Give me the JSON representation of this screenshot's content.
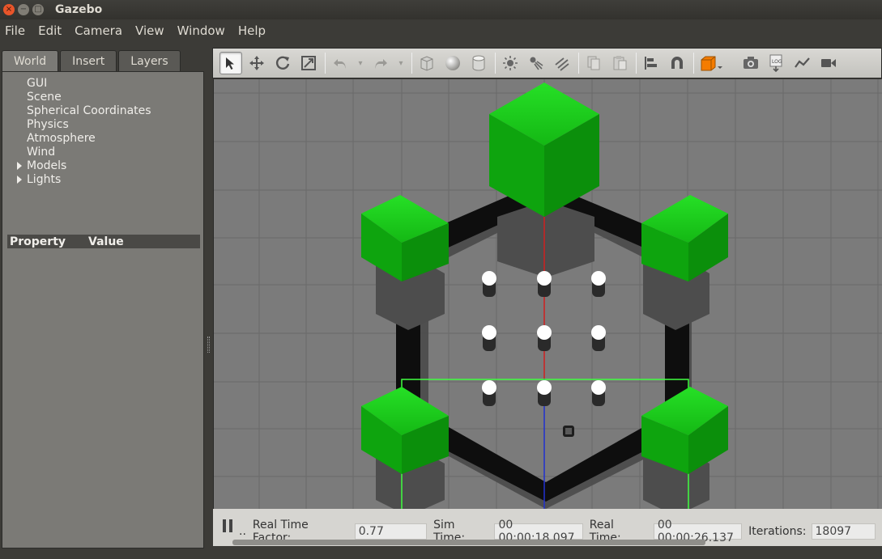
{
  "window": {
    "title": "Gazebo"
  },
  "menu": [
    "File",
    "Edit",
    "Camera",
    "View",
    "Window",
    "Help"
  ],
  "left": {
    "tabs": [
      "World",
      "Insert",
      "Layers"
    ],
    "tree": [
      "GUI",
      "Scene",
      "Spherical Coordinates",
      "Physics",
      "Atmosphere",
      "Wind",
      "Models",
      "Lights"
    ],
    "property_header": {
      "property": "Property",
      "value": "Value"
    }
  },
  "toolbar": {
    "icons": [
      "select-arrow-icon",
      "translate-icon",
      "rotate-icon",
      "scale-icon",
      "undo-icon",
      "redo-icon",
      "box-icon",
      "sphere-icon",
      "cylinder-icon",
      "point-light-icon",
      "spot-light-icon",
      "directional-light-icon",
      "copy-icon",
      "paste-icon",
      "align-icon",
      "snap-icon",
      "view-angle-icon",
      "screenshot-icon",
      "log-icon",
      "plot-icon",
      "record-icon"
    ]
  },
  "status": {
    "dots": "..",
    "rtf_label": "Real Time Factor:",
    "rtf_value": "0.77",
    "sim_label": "Sim Time:",
    "sim_value": "00 00:00:18.097",
    "real_label": "Real Time:",
    "real_value": "00 00:00:26.137",
    "iter_label": "Iterations:",
    "iter_value": "18097"
  },
  "colors": {
    "accent_green": "#0fbf0f",
    "ground": "#7b7b7b",
    "wall": "#101010"
  }
}
